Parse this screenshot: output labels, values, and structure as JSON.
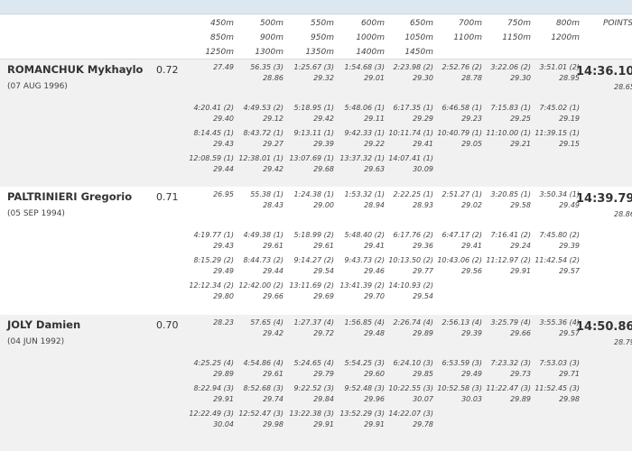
{
  "header": {
    "rows": [
      [
        "450m",
        "500m",
        "550m",
        "600m",
        "650m",
        "700m",
        "750m",
        "800m"
      ],
      [
        "850m",
        "900m",
        "950m",
        "1000m",
        "1050m",
        "1100m",
        "1150m",
        "1200m"
      ],
      [
        "1250m",
        "1300m",
        "1350m",
        "1400m",
        "1450m"
      ]
    ],
    "points_label": "POINTS"
  },
  "athletes": [
    {
      "name": "ROMANCHUK Mykhaylo",
      "dob": "(07 AUG 1996)",
      "reaction": "0.72",
      "final_time": "14:36.10",
      "final_lap": "28.65",
      "rows": [
        [
          [
            "27.49",
            ""
          ],
          [
            "56.35 (3)",
            "28.86"
          ],
          [
            "1:25.67 (3)",
            "29.32"
          ],
          [
            "1:54.68 (3)",
            "29.01"
          ],
          [
            "2:23.98 (2)",
            "29.30"
          ],
          [
            "2:52.76 (2)",
            "28.78"
          ],
          [
            "3:22.06 (2)",
            "29.30"
          ],
          [
            "3:51.01 (2)",
            "28.95"
          ]
        ],
        [
          [
            "4:20.41 (2)",
            "29.40"
          ],
          [
            "4:49.53 (2)",
            "29.12"
          ],
          [
            "5:18.95 (1)",
            "29.42"
          ],
          [
            "5:48.06 (1)",
            "29.11"
          ],
          [
            "6:17.35 (1)",
            "29.29"
          ],
          [
            "6:46.58 (1)",
            "29.23"
          ],
          [
            "7:15.83 (1)",
            "29.25"
          ],
          [
            "7:45.02 (1)",
            "29.19"
          ]
        ],
        [
          [
            "8:14.45 (1)",
            "29.43"
          ],
          [
            "8:43.72 (1)",
            "29.27"
          ],
          [
            "9:13.11 (1)",
            "29.39"
          ],
          [
            "9:42.33 (1)",
            "29.22"
          ],
          [
            "10:11.74 (1)",
            "29.41"
          ],
          [
            "10:40.79 (1)",
            "29.05"
          ],
          [
            "11:10.00 (1)",
            "29.21"
          ],
          [
            "11:39.15 (1)",
            "29.15"
          ]
        ],
        [
          [
            "12:08.59 (1)",
            "29.44"
          ],
          [
            "12:38.01 (1)",
            "29.42"
          ],
          [
            "13:07.69 (1)",
            "29.68"
          ],
          [
            "13:37.32 (1)",
            "29.63"
          ],
          [
            "14:07.41 (1)",
            "30.09"
          ]
        ]
      ]
    },
    {
      "name": "PALTRINIERI Gregorio",
      "dob": "(05 SEP 1994)",
      "reaction": "0.71",
      "final_time": "14:39.79",
      "final_lap": "28.86",
      "rows": [
        [
          [
            "26.95",
            ""
          ],
          [
            "55.38 (1)",
            "28.43"
          ],
          [
            "1:24.38 (1)",
            "29.00"
          ],
          [
            "1:53.32 (1)",
            "28.94"
          ],
          [
            "2:22.25 (1)",
            "28.93"
          ],
          [
            "2:51.27 (1)",
            "29.02"
          ],
          [
            "3:20.85 (1)",
            "29.58"
          ],
          [
            "3:50.34 (1)",
            "29.49"
          ]
        ],
        [
          [
            "4:19.77 (1)",
            "29.43"
          ],
          [
            "4:49.38 (1)",
            "29.61"
          ],
          [
            "5:18.99 (2)",
            "29.61"
          ],
          [
            "5:48.40 (2)",
            "29.41"
          ],
          [
            "6:17.76 (2)",
            "29.36"
          ],
          [
            "6:47.17 (2)",
            "29.41"
          ],
          [
            "7:16.41 (2)",
            "29.24"
          ],
          [
            "7:45.80 (2)",
            "29.39"
          ]
        ],
        [
          [
            "8:15.29 (2)",
            "29.49"
          ],
          [
            "8:44.73 (2)",
            "29.44"
          ],
          [
            "9:14.27 (2)",
            "29.54"
          ],
          [
            "9:43.73 (2)",
            "29.46"
          ],
          [
            "10:13.50 (2)",
            "29.77"
          ],
          [
            "10:43.06 (2)",
            "29.56"
          ],
          [
            "11:12.97 (2)",
            "29.91"
          ],
          [
            "11:42.54 (2)",
            "29.57"
          ]
        ],
        [
          [
            "12:12.34 (2)",
            "29.80"
          ],
          [
            "12:42.00 (2)",
            "29.66"
          ],
          [
            "13:11.69 (2)",
            "29.69"
          ],
          [
            "13:41.39 (2)",
            "29.70"
          ],
          [
            "14:10.93 (2)",
            "29.54"
          ]
        ]
      ]
    },
    {
      "name": "JOLY Damien",
      "dob": "(04 JUN 1992)",
      "reaction": "0.70",
      "final_time": "14:50.86",
      "final_lap": "28.79",
      "rows": [
        [
          [
            "28.23",
            ""
          ],
          [
            "57.65 (4)",
            "29.42"
          ],
          [
            "1:27.37 (4)",
            "29.72"
          ],
          [
            "1:56.85 (4)",
            "29.48"
          ],
          [
            "2:26.74 (4)",
            "29.89"
          ],
          [
            "2:56.13 (4)",
            "29.39"
          ],
          [
            "3:25.79 (4)",
            "29.66"
          ],
          [
            "3:55.36 (4)",
            "29.57"
          ]
        ],
        [
          [
            "4:25.25 (4)",
            "29.89"
          ],
          [
            "4:54.86 (4)",
            "29.61"
          ],
          [
            "5:24.65 (4)",
            "29.79"
          ],
          [
            "5:54.25 (3)",
            "29.60"
          ],
          [
            "6:24.10 (3)",
            "29.85"
          ],
          [
            "6:53.59 (3)",
            "29.49"
          ],
          [
            "7:23.32 (3)",
            "29.73"
          ],
          [
            "7:53.03 (3)",
            "29.71"
          ]
        ],
        [
          [
            "8:22.94 (3)",
            "29.91"
          ],
          [
            "8:52.68 (3)",
            "29.74"
          ],
          [
            "9:22.52 (3)",
            "29.84"
          ],
          [
            "9:52.48 (3)",
            "29.96"
          ],
          [
            "10:22.55 (3)",
            "30.07"
          ],
          [
            "10:52.58 (3)",
            "30.03"
          ],
          [
            "11:22.47 (3)",
            "29.89"
          ],
          [
            "11:52.45 (3)",
            "29.98"
          ]
        ],
        [
          [
            "12:22.49 (3)",
            "30.04"
          ],
          [
            "12:52.47 (3)",
            "29.98"
          ],
          [
            "13:22.38 (3)",
            "29.91"
          ],
          [
            "13:52.29 (3)",
            "29.91"
          ],
          [
            "14:22.07 (3)",
            "29.78"
          ]
        ]
      ]
    }
  ]
}
